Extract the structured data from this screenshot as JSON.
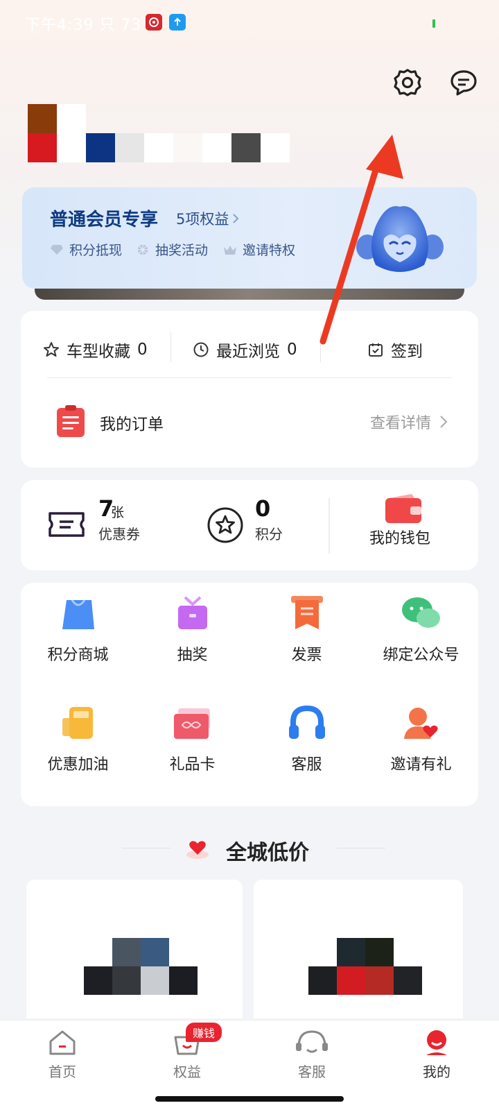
{
  "status_bar": {
    "time": "下午4:39 只 73"
  },
  "header": {
    "settings_icon": "gear-icon",
    "message_icon": "chat-bubble-icon"
  },
  "member_card": {
    "title": "普通会员专享",
    "benefits_link": "5项权益",
    "perks": [
      "积分抵现",
      "抽奖活动",
      "邀请特权"
    ]
  },
  "quick_links": [
    {
      "label": "车型收藏",
      "count": "0"
    },
    {
      "label": "最近浏览",
      "count": "0"
    },
    {
      "label": "签到"
    }
  ],
  "order": {
    "label": "我的订单",
    "detail": "查看详情"
  },
  "assets": {
    "coupon": {
      "count": "7",
      "unit": "张",
      "label": "优惠券"
    },
    "points": {
      "count": "0",
      "label": "积分"
    },
    "wallet": {
      "label": "我的钱包"
    }
  },
  "services": [
    {
      "label": "积分商城",
      "icon": "shopping-bag-icon"
    },
    {
      "label": "抽奖",
      "icon": "gift-box-icon"
    },
    {
      "label": "发票",
      "icon": "invoice-icon"
    },
    {
      "label": "绑定公众号",
      "icon": "wechat-icon"
    },
    {
      "label": "优惠加油",
      "icon": "fuel-pump-icon"
    },
    {
      "label": "礼品卡",
      "icon": "gift-card-icon"
    },
    {
      "label": "客服",
      "icon": "headset-icon"
    },
    {
      "label": "邀请有礼",
      "icon": "invite-friend-icon"
    }
  ],
  "section": {
    "title": "全城低价"
  },
  "tab_bar": {
    "tabs": [
      "首页",
      "权益",
      "客服",
      "我的"
    ],
    "badge": "赚钱",
    "active": "我的"
  },
  "colors": {
    "accent_red": "#e8242f",
    "member_blue": "#0d3a82"
  }
}
